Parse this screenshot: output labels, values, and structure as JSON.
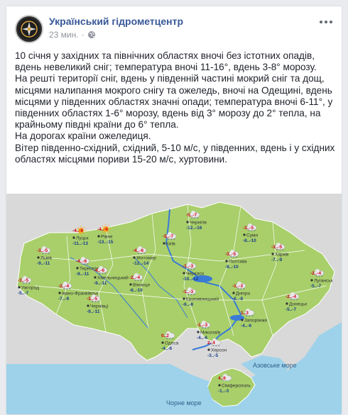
{
  "post": {
    "page_name": "Український гідрометцентр",
    "time": "23 мин.",
    "separator": "·",
    "paragraphs": [
      "10 січня у західних та північних областях вночі без істотних опадів, вдень невеликий сніг; температура вночі 11-16°, вдень 3-8° морозу.",
      "На решті території сніг, вдень у південній частині мокрий сніг та дощ, місцями налипання мокрого снігу та ожеледь, вночі на Одещині, вдень місцями у південних областях значні опади; температура вночі 6-11°, у південних областях 1-6° морозу, вдень від 3° морозу до 2° тепла, на крайньому півдні країни до 6° тепла.",
      "На дорогах країни ожеледиця.",
      "Вітер південно-східний, східний, 5-10 м/с, у південних, вдень і у східних областях місцями пориви 15-20 м/с, хуртовини."
    ]
  },
  "map": {
    "land_color": "#a8cf6a",
    "sea_color": "#9ed2ea",
    "neighbor_color": "#d9d9d9",
    "river_color": "#3a7bd5",
    "seas": {
      "azov": "Азовське море",
      "black": "Чорне море"
    },
    "cities": [
      {
        "name": "Луцьк",
        "day": "-4..-6",
        "night": "-11..-13",
        "icon": "sun-icon"
      },
      {
        "name": "Рівне",
        "day": "-4..-6",
        "night": "-13..-15",
        "icon": "sun-icon"
      },
      {
        "name": "Житомир",
        "day": "-4..-6",
        "night": "-12..-14",
        "icon": "cloud-snow-icon"
      },
      {
        "name": "Київ",
        "day": "-5..-7",
        "night": "",
        "icon": "cloud-snow-icon"
      },
      {
        "name": "Чернігів",
        "day": "-5..-7",
        "night": "-12..-16",
        "icon": "cloud-snow-icon"
      },
      {
        "name": "Суми",
        "day": "-3..-5",
        "night": "-8..-10",
        "icon": "cloud-snow-icon"
      },
      {
        "name": "Харків",
        "day": "-3..-5",
        "night": "-7..-9",
        "icon": "cloud-snow-icon"
      },
      {
        "name": "Полтава",
        "day": "-3..-5",
        "night": "-8..-10",
        "icon": "cloud-snow-icon"
      },
      {
        "name": "Луганськ",
        "day": "-2..-4",
        "night": "-5..-7",
        "icon": "cloud-snow-icon"
      },
      {
        "name": "Львів",
        "day": "-3..-5",
        "night": "-9..-11",
        "icon": "cloud-snow-icon"
      },
      {
        "name": "Тернопіль",
        "day": "-4..-6",
        "night": "-9..-11",
        "icon": "cloud-snow-icon"
      },
      {
        "name": "Хмельницький",
        "day": "-4..-6",
        "night": "-9..-11",
        "icon": "cloud-snow-icon"
      },
      {
        "name": "Ужгород",
        "day": "-3..-5",
        "night": "-5..-7",
        "icon": "cloud-snow-icon"
      },
      {
        "name": "Івано-Франківськ",
        "day": "-2..-4",
        "night": "-7..-9",
        "icon": "cloud-snow-icon"
      },
      {
        "name": "Чернівці",
        "day": "-3..-5",
        "night": "-9..-11",
        "icon": "cloud-snow-icon"
      },
      {
        "name": "Вінниця",
        "day": "-2..-4",
        "night": "-8..-10",
        "icon": "cloud-snow-icon"
      },
      {
        "name": "Черкаси",
        "day": "-1..-3",
        "night": "-10..-12",
        "icon": "cloud-snow-icon"
      },
      {
        "name": "Кропивницький",
        "day": "-1..-3",
        "night": "-6..-8",
        "icon": "cloud-snow-icon"
      },
      {
        "name": "Дніпро",
        "day": "-1..-3",
        "night": "-6..-8",
        "icon": "cloud-snow-icon"
      },
      {
        "name": "Донецьк",
        "day": "-2..-4",
        "night": "-5..-7",
        "icon": "cloud-snow-icon"
      },
      {
        "name": "Запоріжжя",
        "day": "1..3",
        "night": "-4..-6",
        "icon": "cloud-snow-icon"
      },
      {
        "name": "Миколаїв",
        "day": "-1..-3",
        "night": "-4..-6",
        "icon": "cloud-snow-icon"
      },
      {
        "name": "Одеса",
        "day": "0..2",
        "night": "-4..-6",
        "icon": "cloud-snow-icon"
      },
      {
        "name": "Херсон",
        "day": "2..4",
        "night": "-3..-5",
        "icon": "cloud-snow-icon"
      },
      {
        "name": "Сімферополь",
        "day": "4..6",
        "night": "-1..-3",
        "icon": "cloud-rain-icon"
      }
    ]
  }
}
